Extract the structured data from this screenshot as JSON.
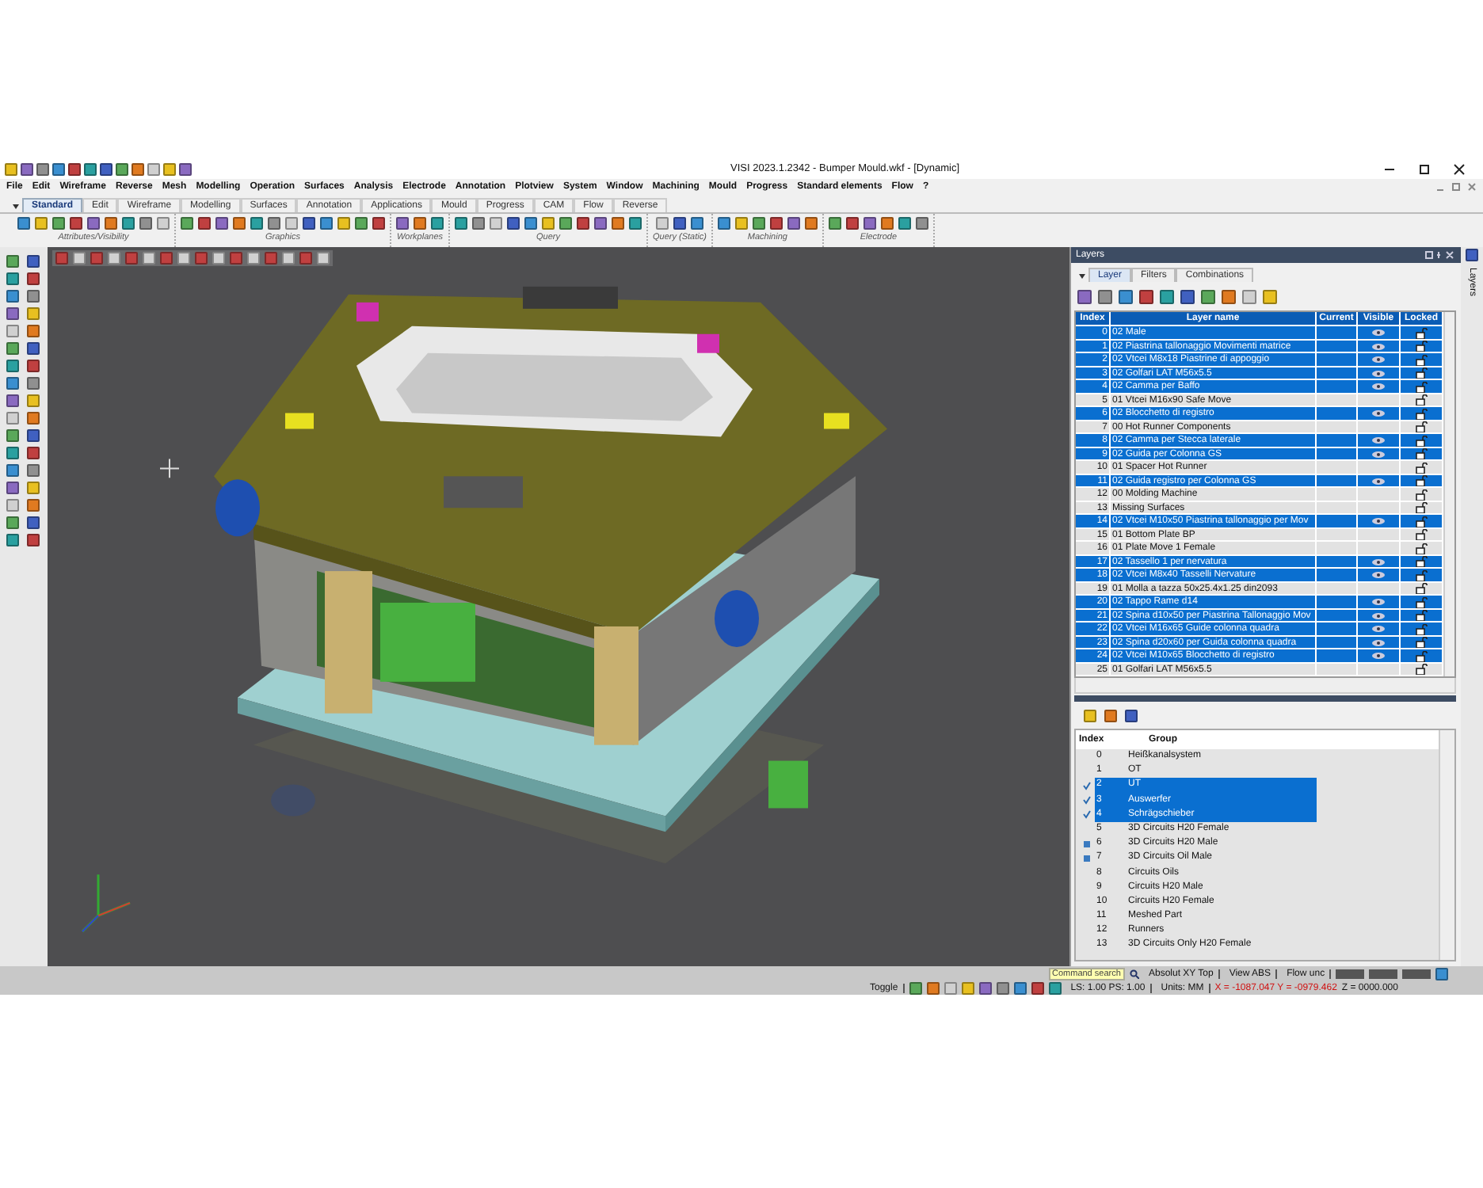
{
  "window": {
    "title": "VISI 2023.1.2342 - Bumper Mould.wkf - [Dynamic]"
  },
  "menu": [
    "File",
    "Edit",
    "Wireframe",
    "Reverse",
    "Mesh",
    "Modelling",
    "Operation",
    "Surfaces",
    "Analysis",
    "Electrode",
    "Annotation",
    "Plotview",
    "System",
    "Window",
    "Machining",
    "Mould",
    "Progress",
    "Standard elements",
    "Flow",
    "?"
  ],
  "ribbon": {
    "tabs": [
      {
        "label": "Standard",
        "selected": true
      },
      {
        "label": "Edit",
        "selected": false
      },
      {
        "label": "Wireframe",
        "selected": false
      },
      {
        "label": "Modelling",
        "selected": false
      },
      {
        "label": "Surfaces",
        "selected": false
      },
      {
        "label": "Annotation",
        "selected": false
      },
      {
        "label": "Applications",
        "selected": false
      },
      {
        "label": "Mould",
        "selected": false
      },
      {
        "label": "Progress",
        "selected": false
      },
      {
        "label": "CAM",
        "selected": false
      },
      {
        "label": "Flow",
        "selected": false
      },
      {
        "label": "Reverse",
        "selected": false
      }
    ],
    "groups": [
      "Attributes/Visibility",
      "Graphics",
      "Workplanes",
      "Query",
      "Query (Static)",
      "Machining",
      "Electrode"
    ]
  },
  "layers_panel": {
    "title": "Layers",
    "tabs": [
      {
        "label": "Layer",
        "selected": true
      },
      {
        "label": "Filters",
        "selected": false
      },
      {
        "label": "Combinations",
        "selected": false
      }
    ],
    "columns": [
      "Index",
      "Layer name",
      "Current",
      "Visible",
      "Locked"
    ],
    "rows": [
      {
        "index": "0",
        "name": "02 Male",
        "selected": true,
        "visible": true
      },
      {
        "index": "1",
        "name": "02 Piastrina tallonaggio Movimenti matrice",
        "selected": true,
        "visible": true
      },
      {
        "index": "2",
        "name": "02 Vtcei M8x18 Piastrine di appoggio",
        "selected": true,
        "visible": true
      },
      {
        "index": "3",
        "name": "02 Golfari LAT M56x5.5",
        "selected": true,
        "visible": true
      },
      {
        "index": "4",
        "name": "02 Camma per Baffo",
        "selected": true,
        "visible": true
      },
      {
        "index": "5",
        "name": "01 Vtcei M16x90 Safe Move",
        "selected": false,
        "visible": false
      },
      {
        "index": "6",
        "name": "02 Blocchetto di registro",
        "selected": true,
        "visible": true
      },
      {
        "index": "7",
        "name": "00 Hot Runner Components",
        "selected": false,
        "visible": false
      },
      {
        "index": "8",
        "name": "02 Camma per Stecca laterale",
        "selected": true,
        "visible": true
      },
      {
        "index": "9",
        "name": "02 Guida per Colonna GS",
        "selected": true,
        "visible": true
      },
      {
        "index": "10",
        "name": "01 Spacer Hot Runner",
        "selected": false,
        "visible": false
      },
      {
        "index": "11",
        "name": "02 Guida registro per Colonna GS",
        "selected": true,
        "visible": true
      },
      {
        "index": "12",
        "name": "00 Molding Machine",
        "selected": false,
        "visible": false
      },
      {
        "index": "13",
        "name": "Missing Surfaces",
        "selected": false,
        "visible": false
      },
      {
        "index": "14",
        "name": "02 Vtcei M10x50 Piastrina tallonaggio per Mov",
        "selected": true,
        "visible": true
      },
      {
        "index": "15",
        "name": "01 Bottom Plate BP",
        "selected": false,
        "visible": false
      },
      {
        "index": "16",
        "name": "01 Plate Move 1 Female",
        "selected": false,
        "visible": false
      },
      {
        "index": "17",
        "name": "02 Tassello 1 per nervatura",
        "selected": true,
        "visible": true
      },
      {
        "index": "18",
        "name": "02 Vtcei M8x40 Tasselli Nervature",
        "selected": true,
        "visible": true
      },
      {
        "index": "19",
        "name": "01 Molla a tazza 50x25.4x1.25 din2093",
        "selected": false,
        "visible": false
      },
      {
        "index": "20",
        "name": "02 Tappo Rame d14",
        "selected": true,
        "visible": true
      },
      {
        "index": "21",
        "name": "02 Spina d10x50 per Piastrina Tallonaggio Mov",
        "selected": true,
        "visible": true
      },
      {
        "index": "22",
        "name": "02 Vtcei M16x65 Guide colonna quadra",
        "selected": true,
        "visible": true
      },
      {
        "index": "23",
        "name": "02 Spina d20x60 per Guida colonna quadra",
        "selected": true,
        "visible": true
      },
      {
        "index": "24",
        "name": "02 Vtcei M10x65 Blocchetto di registro",
        "selected": true,
        "visible": true
      },
      {
        "index": "25",
        "name": "01 Golfari LAT M56x5.5",
        "selected": false,
        "visible": false
      }
    ]
  },
  "groups_panel": {
    "columns": [
      "Index",
      "Group"
    ],
    "rows": [
      {
        "index": "0",
        "name": "Heißkanalsystem",
        "selected": false,
        "checked": false,
        "flagged": false
      },
      {
        "index": "1",
        "name": "OT",
        "selected": false,
        "checked": false,
        "flagged": false
      },
      {
        "index": "2",
        "name": "UT",
        "selected": true,
        "checked": true,
        "flagged": false
      },
      {
        "index": "3",
        "name": "Auswerfer",
        "selected": true,
        "checked": true,
        "flagged": false
      },
      {
        "index": "4",
        "name": "Schrägschieber",
        "selected": true,
        "checked": true,
        "flagged": false
      },
      {
        "index": "5",
        "name": "3D Circuits H20 Female",
        "selected": false,
        "checked": false,
        "flagged": false
      },
      {
        "index": "6",
        "name": "3D Circuits H20 Male",
        "selected": false,
        "checked": false,
        "flagged": true
      },
      {
        "index": "7",
        "name": "3D Circuits Oil Male",
        "selected": false,
        "checked": false,
        "flagged": true
      },
      {
        "index": "8",
        "name": "Circuits Oils",
        "selected": false,
        "checked": false,
        "flagged": false
      },
      {
        "index": "9",
        "name": "Circuits H20 Male",
        "selected": false,
        "checked": false,
        "flagged": false
      },
      {
        "index": "10",
        "name": "Circuits H20 Female",
        "selected": false,
        "checked": false,
        "flagged": false
      },
      {
        "index": "11",
        "name": "Meshed Part",
        "selected": false,
        "checked": false,
        "flagged": false
      },
      {
        "index": "12",
        "name": "Runners",
        "selected": false,
        "checked": false,
        "flagged": false
      },
      {
        "index": "13",
        "name": "3D Circuits Only H20 Female",
        "selected": false,
        "checked": false,
        "flagged": false
      }
    ]
  },
  "side_tab": {
    "label": "Layers"
  },
  "status_bar": {
    "command_search": {
      "placeholder": "Command search"
    },
    "view": "Absolut XY Top",
    "view_mode": "View ABS",
    "flow": "Flow unc",
    "toggle": "Toggle",
    "scale": "LS: 1.00 PS: 1.00",
    "units": "Units: MM",
    "coords_xy": "X = -1087.047 Y = -0979.462",
    "coord_z": "Z = 0000.000"
  }
}
